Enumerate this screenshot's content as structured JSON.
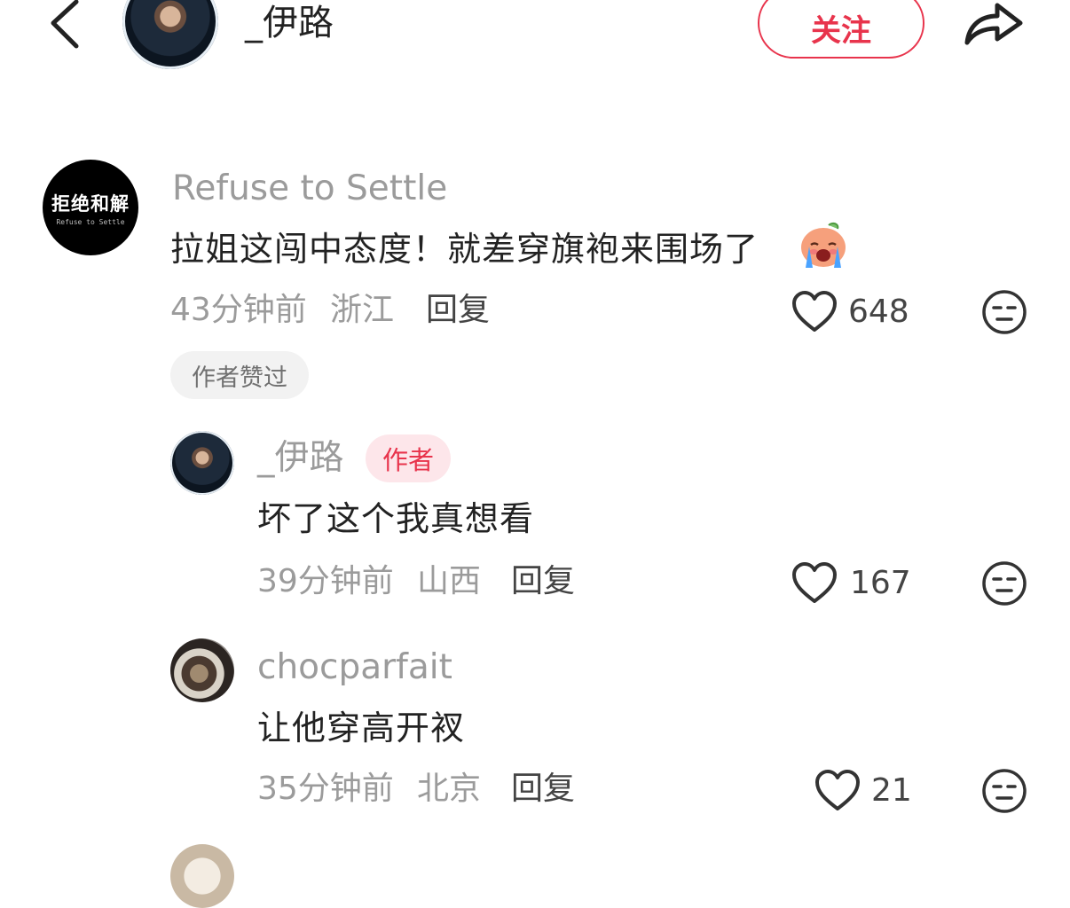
{
  "header": {
    "back_icon": "chevron-left-icon",
    "username": "_伊路",
    "follow_label": "关注",
    "share_icon": "share-arrow-icon",
    "accent_color": "#e8344c"
  },
  "comments": [
    {
      "avatar_text": "拒绝和解",
      "avatar_subtext": "Refuse to Settle",
      "username": "Refuse to Settle",
      "content": "拉姐这闯中态度！就差穿旗袍来围场了",
      "emoji": "crying-face-emoji",
      "time": "43分钟前",
      "location": "浙江",
      "reply_label": "回复",
      "likes": "648",
      "badge": "作者赞过"
    },
    {
      "username": "_伊路",
      "author_badge": "作者",
      "content": "坏了这个我真想看",
      "time": "39分钟前",
      "location": "山西",
      "reply_label": "回复",
      "likes": "167"
    },
    {
      "username": "chocparfait",
      "content": "让他穿高开衩",
      "time": "35分钟前",
      "location": "北京",
      "reply_label": "回复",
      "likes": "21"
    }
  ]
}
